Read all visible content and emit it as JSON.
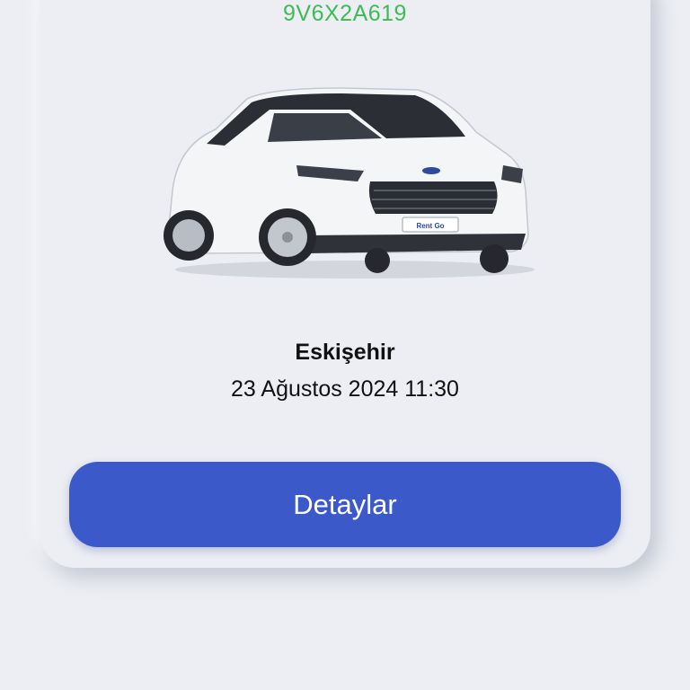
{
  "reservation": {
    "plate": "9V6X2A619",
    "car_image_icon": "car-photo",
    "city": "Eskişehir",
    "datetime": "23 Ağustos 2024 11:30",
    "details_button_label": "Detaylar"
  },
  "colors": {
    "background": "#eceef3",
    "plate_text": "#3fba56",
    "button": "#3b59c9",
    "button_text": "#ffffff"
  }
}
